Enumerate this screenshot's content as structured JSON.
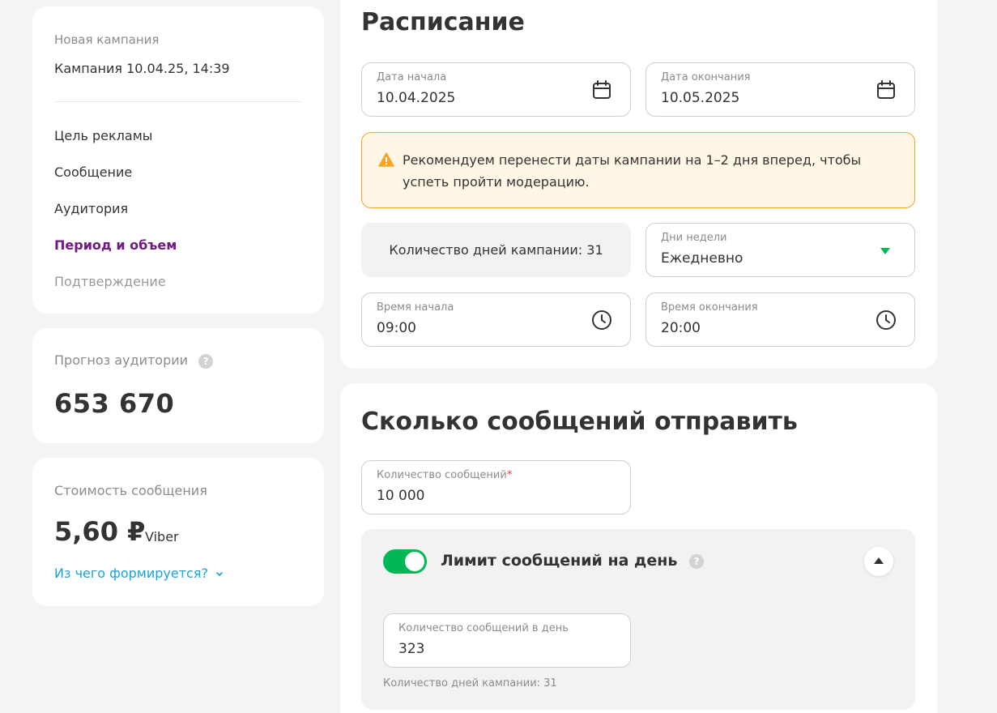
{
  "sidebar": {
    "subtitle": "Новая кампания",
    "campaign_name": "Кампания 10.04.25, 14:39",
    "steps": [
      {
        "label": "Цель рекламы",
        "state": "done"
      },
      {
        "label": "Сообщение",
        "state": "done"
      },
      {
        "label": "Аудитория",
        "state": "done"
      },
      {
        "label": "Период и объем",
        "state": "active"
      },
      {
        "label": "Подтверждение",
        "state": "disabled"
      }
    ]
  },
  "forecast": {
    "title": "Прогноз аудитории",
    "help_icon": "?",
    "value": "653 670"
  },
  "price": {
    "title": "Стоимость сообщения",
    "value": "5,60 ₽",
    "channel": "Viber",
    "link": "Из чего формируется?"
  },
  "schedule": {
    "title": "Расписание",
    "start_date": {
      "label": "Дата начала",
      "value": "10.04.2025",
      "icon": "calendar-icon"
    },
    "end_date": {
      "label": "Дата окончания",
      "value": "10.05.2025",
      "icon": "calendar-icon"
    },
    "warning": "Рекомендуем перенести даты кампании на 1–2 дня вперед, чтобы успеть пройти модерацию.",
    "days_count": "Количество дней кампании: 31",
    "weekdays": {
      "label": "Дни недели",
      "value": "Ежедневно",
      "icon": "chevron-down-icon"
    },
    "start_time": {
      "label": "Время начала",
      "value": "09:00",
      "icon": "clock-icon"
    },
    "end_time": {
      "label": "Время окончания",
      "value": "20:00",
      "icon": "clock-icon"
    }
  },
  "messages": {
    "title": "Сколько сообщений отправить",
    "count_field": {
      "label": "Количество сообщений",
      "required_mark": "*",
      "value": "10 000"
    },
    "daily_limit": {
      "title": "Лимит сообщений на день",
      "enabled": true,
      "per_day_field": {
        "label": "Количество сообщений в день",
        "value": "323"
      },
      "note": "Количество дней кампании: 31"
    }
  },
  "colors": {
    "accent_purple": "#731982",
    "accent_green": "#00b956",
    "link_blue": "#1aa1d9",
    "warning_border": "#f5a623",
    "warning_bg": "#fff6e6"
  }
}
